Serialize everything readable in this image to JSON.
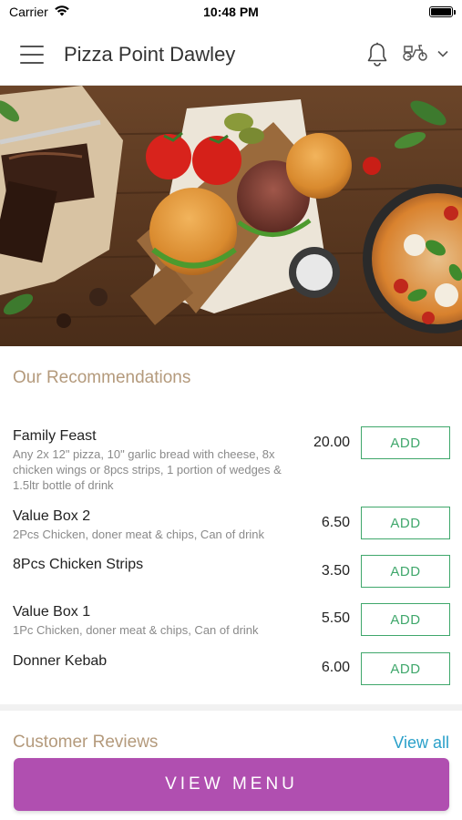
{
  "status_bar": {
    "carrier": "Carrier",
    "time": "10:48 PM"
  },
  "header": {
    "title": "Pizza Point Dawley",
    "icons": [
      "menu-icon",
      "bell-icon",
      "scooter-icon",
      "chevron-down-icon"
    ]
  },
  "recommendations": {
    "title": "Our Recommendations",
    "add_label": "ADD",
    "items": [
      {
        "name": "Family Feast",
        "description": "Any 2x 12\" pizza, 10\" garlic bread with cheese, 8x chicken wings or 8pcs strips, 1 portion of wedges & 1.5ltr bottle of drink",
        "price": "20.00"
      },
      {
        "name": "Value Box 2",
        "description": "2Pcs Chicken, doner meat & chips, Can of drink",
        "price": "6.50"
      },
      {
        "name": "8Pcs Chicken Strips",
        "description": "",
        "price": "3.50"
      },
      {
        "name": "Value Box 1",
        "description": "1Pc Chicken, doner meat & chips, Can of drink",
        "price": "5.50"
      },
      {
        "name": "Donner Kebab",
        "description": "",
        "price": "6.00"
      }
    ]
  },
  "reviews": {
    "title": "Customer Reviews",
    "view_all_label": "View all"
  },
  "footer": {
    "view_menu_label": "VIEW MENU"
  },
  "colors": {
    "accent_purple": "#b04fb0",
    "add_green": "#3fa76b",
    "section_title_tan": "#b49a7c",
    "link_blue": "#2aa0c9"
  }
}
